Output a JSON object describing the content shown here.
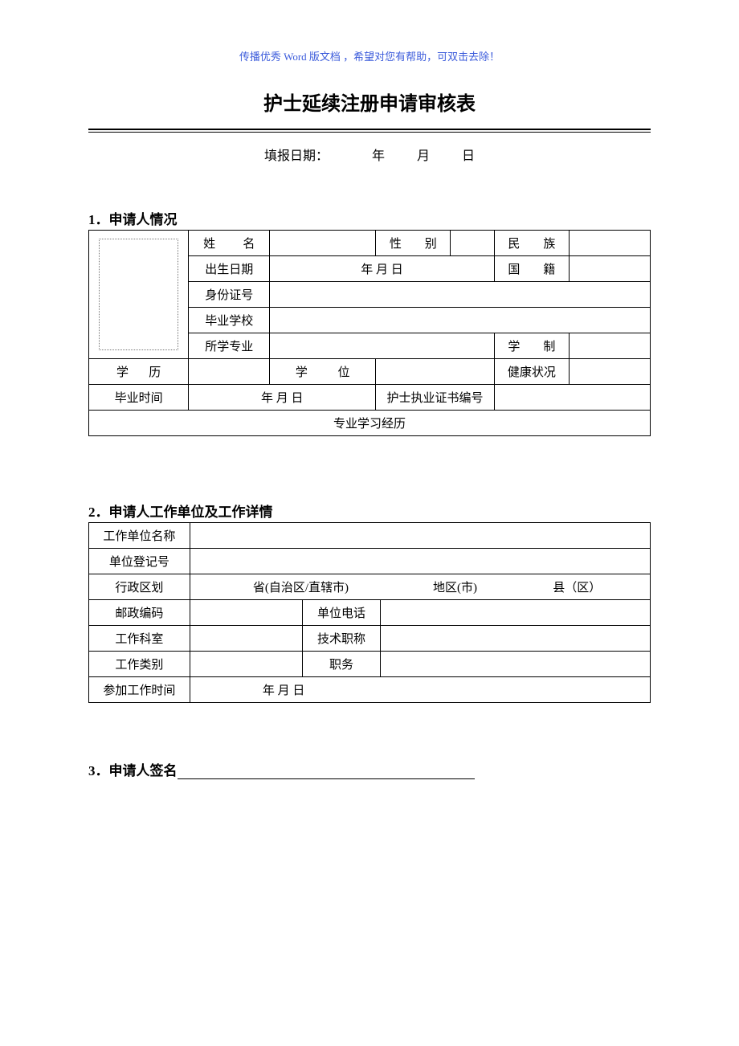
{
  "watermark": "传播优秀 Word 版文档 ，希望对您有帮助，可双击去除！",
  "title": "护士延续注册申请审核表",
  "fill_date": {
    "label": "填报日期：",
    "year": "年",
    "month": "月",
    "day": "日"
  },
  "section1": {
    "heading": "1．申请人情况",
    "labels": {
      "name": "姓    名",
      "gender": "性    别",
      "ethnicity": "民    族",
      "birthdate": "出生日期",
      "birth_ymd": "年     月     日",
      "nationality": "国    籍",
      "id_no": "身份证号",
      "grad_school": "毕业学校",
      "major": "所学专业",
      "edu_system": "学    制",
      "education": "学    历",
      "degree": "学    位",
      "health": "健康状况",
      "grad_time": "毕业时间",
      "grad_ymd": "年    月    日",
      "license_no": "护士执业证书编号",
      "study_history": "专业学习经历"
    }
  },
  "section2": {
    "heading": "2．申请人工作单位及工作详情",
    "labels": {
      "org_name": "工作单位名称",
      "org_reg_no": "单位登记号",
      "admin_region": "行政区划",
      "province": "省(自治区/直辖市)",
      "city": "地区(市)",
      "county": "县（区）",
      "postcode": "邮政编码",
      "org_phone": "单位电话",
      "department": "工作科室",
      "tech_title": "技术职称",
      "job_type": "工作类别",
      "position": "职务",
      "start_work": "参加工作时间",
      "ymd": "年        月      日"
    }
  },
  "section3": {
    "heading": "3．申请人签名"
  }
}
